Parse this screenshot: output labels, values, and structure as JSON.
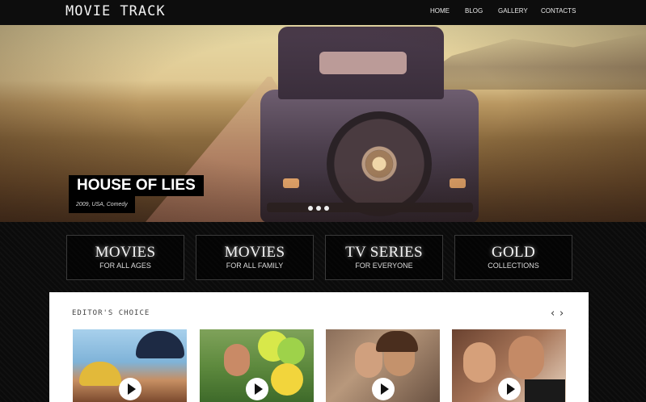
{
  "header": {
    "logo": "MOVIE TRACK",
    "nav": [
      "HOME",
      "BLOG",
      "GALLERY",
      "CONTACTS"
    ]
  },
  "hero": {
    "title": "HOUSE OF LIES",
    "subtitle": "2009, USA, Comedy",
    "slides": 3,
    "active_slide": 1
  },
  "categories": [
    {
      "title": "MOVIES",
      "sub": "FOR ALL AGES"
    },
    {
      "title": "MOVIES",
      "sub": "FOR ALL FAMILY"
    },
    {
      "title": "TV SERIES",
      "sub": "FOR EVERYONE"
    },
    {
      "title": "GOLD",
      "sub": "COLLECTIONS"
    }
  ],
  "editors_choice": {
    "title": "EDITOR'S CHOICE",
    "prev_icon": "chevron-left-icon",
    "next_icon": "chevron-right-icon",
    "thumbnails": [
      "firefighters",
      "girl-with-balloons",
      "couple-kissing",
      "couple-smiling"
    ]
  },
  "colors": {
    "background": "#0b0b0b",
    "panel": "#ffffff",
    "accent_text": "#f4f4f4"
  }
}
